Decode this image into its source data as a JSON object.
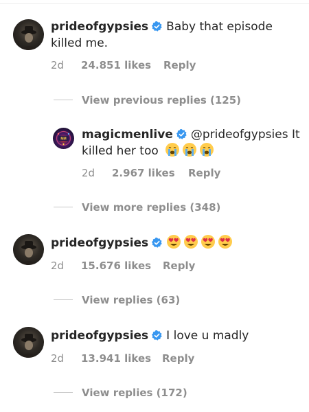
{
  "colors": {
    "text": "#262626",
    "muted": "#8e8e8e",
    "verified": "#3897f0"
  },
  "comments": [
    {
      "username": "prideofgypsies",
      "verified": true,
      "text_line1": "Baby that episode",
      "text_line2": "killed me.",
      "time": "2d",
      "likes": "24.851 likes",
      "reply": "Reply",
      "avatar_icon": "hat-silhouette-avatar"
    },
    {
      "view_replies": "View previous replies (125)"
    },
    {
      "username": "magicmenlive",
      "verified": true,
      "text_line1": "@prideofgypsies It",
      "text_line2": "killed her too",
      "emojis": [
        "crying-face-emoji",
        "crying-face-emoji",
        "crying-face-emoji"
      ],
      "time": "2d",
      "likes": "2.967 likes",
      "reply": "Reply",
      "avatar_icon": "magicmen-logo-avatar"
    },
    {
      "view_replies": "View more replies (348)"
    },
    {
      "username": "prideofgypsies",
      "verified": true,
      "emojis": [
        "heart-eyes-emoji",
        "heart-eyes-emoji",
        "heart-eyes-emoji",
        "heart-eyes-emoji"
      ],
      "time": "2d",
      "likes": "15.676 likes",
      "reply": "Reply",
      "avatar_icon": "hat-silhouette-avatar"
    },
    {
      "view_replies": "View replies (63)"
    },
    {
      "username": "prideofgypsies",
      "verified": true,
      "text_line1": "I love u madly",
      "time": "2d",
      "likes": "13.941 likes",
      "reply": "Reply",
      "avatar_icon": "hat-silhouette-avatar"
    },
    {
      "view_replies": "View replies (172)"
    }
  ]
}
